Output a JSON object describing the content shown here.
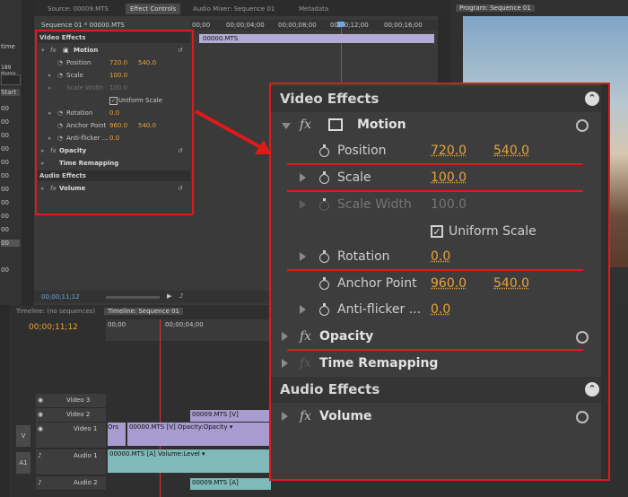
{
  "left_panel": {
    "labels": [
      "time",
      "189 Items",
      "Start",
      "00",
      "00",
      "00",
      "00",
      "00",
      "00",
      "00",
      "00",
      "00",
      "00",
      "00",
      "00"
    ]
  },
  "top_tabs": {
    "source": "Source: 00009.MTS",
    "effect_controls": "Effect Controls",
    "audio_mixer": "Audio Mixer: Sequence 01",
    "metadata": "Metadata",
    "program": "Program: Sequence 01"
  },
  "effect_controls": {
    "sequence_label": "Sequence 01 * 00000.MTS",
    "ruler": [
      "00;00",
      "00;00;04;00",
      "00;00;08;00",
      "00;00;12;00",
      "00;00;16;00"
    ],
    "clip_name": "00000.MTS",
    "video_effects": "Video Effects",
    "motion": "Motion",
    "position": {
      "label": "Position",
      "x": "720.0",
      "y": "540.0"
    },
    "scale": {
      "label": "Scale",
      "value": "100.0"
    },
    "scale_width": {
      "label": "Scale Width",
      "value": "100.0"
    },
    "uniform_scale": "Uniform Scale",
    "rotation": {
      "label": "Rotation",
      "value": "0.0"
    },
    "anchor_point": {
      "label": "Anchor Point",
      "x": "960.0",
      "y": "540.0"
    },
    "anti_flicker": {
      "label": "Anti-flicker ...",
      "label_short": "Anti-flicker ...",
      "value": "0.0"
    },
    "opacity": "Opacity",
    "time_remapping": "Time Remapping",
    "audio_effects": "Audio Effects",
    "volume": "Volume",
    "timecode": "00;00;11;12"
  },
  "timeline": {
    "tab_inactive": "Timeline: (no sequences)",
    "tab_active": "Timeline: Sequence 01",
    "timecode": "00;00;11;12",
    "ruler": [
      "00;00",
      "00;00;04;00"
    ],
    "tracks": {
      "video3": "Video 3",
      "video2": "Video 2",
      "video1": "Video 1",
      "audio1": "Audio 1",
      "audio2": "Audio 2",
      "v": "V",
      "a1": "A1"
    },
    "clips": {
      "v2": "00009.MTS [V]",
      "v1_prefix": "Ors",
      "v1": "00000.MTS [V] Opacity:Opacity ▾",
      "a1": "00000.MTS [A] Volume:Level ▾",
      "a2": "00009.MTS [A]"
    }
  },
  "zoom": {
    "video_effects": "Video Effects",
    "motion": "Motion",
    "position": {
      "label": "Position",
      "x": "720.0",
      "y": "540.0"
    },
    "scale": {
      "label": "Scale",
      "value": "100.0"
    },
    "scale_width": {
      "label": "Scale Width",
      "value": "100.0"
    },
    "uniform_scale": "Uniform Scale",
    "rotation": {
      "label": "Rotation",
      "value": "0.0"
    },
    "anchor_point": {
      "label": "Anchor Point",
      "x": "960.0",
      "y": "540.0"
    },
    "anti_flicker": {
      "label": "Anti-flicker ...",
      "value": "0.0"
    },
    "opacity": "Opacity",
    "time_remapping": "Time Remapping",
    "audio_effects": "Audio Effects",
    "volume": "Volume"
  },
  "colors": {
    "accent_value": "#e8a33a",
    "annotation": "#e01919",
    "clip_video": "#a79bd0",
    "clip_audio": "#7fb9b9"
  }
}
